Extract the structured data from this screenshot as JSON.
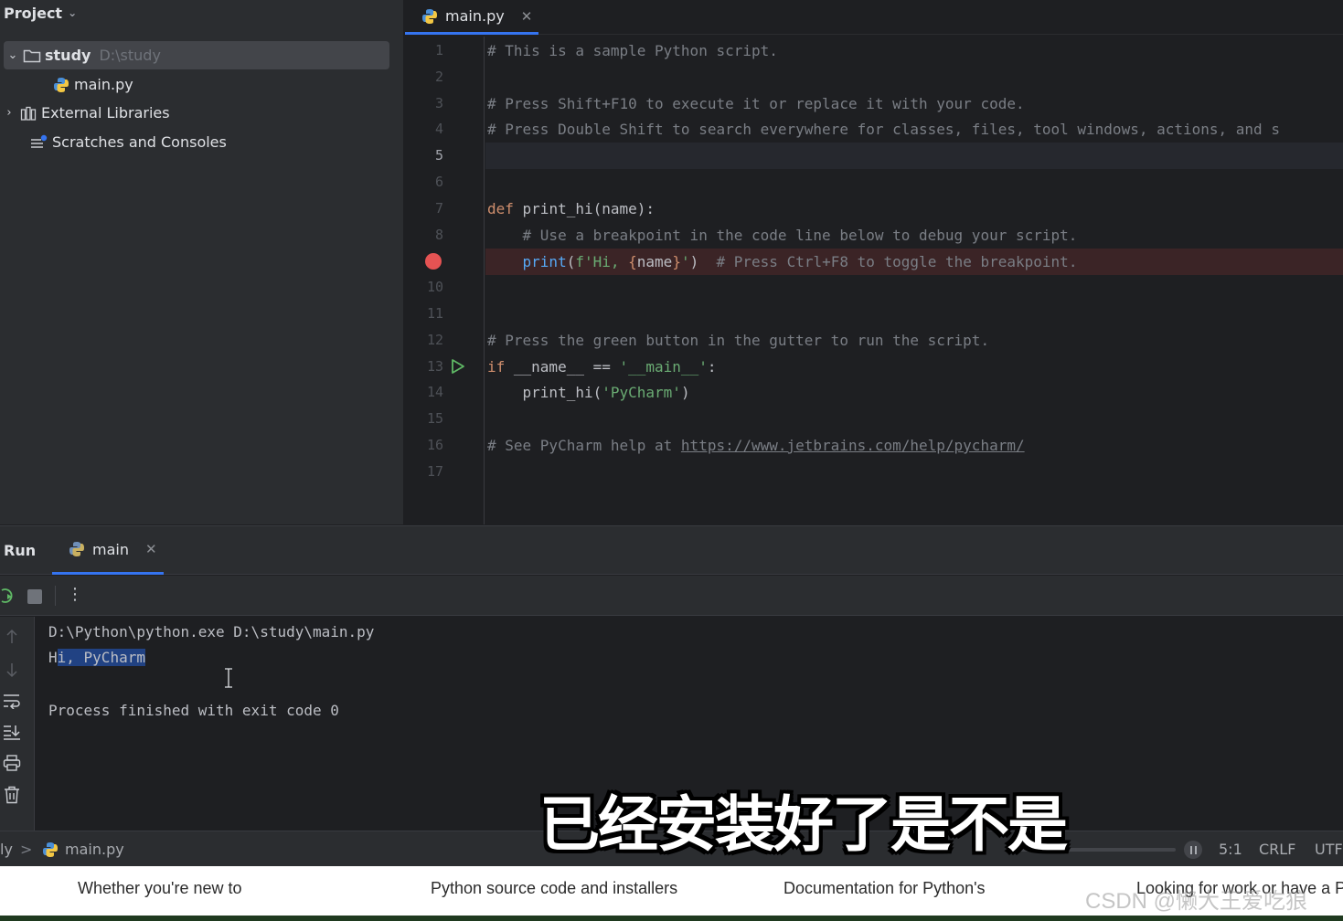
{
  "project": {
    "header": "Project",
    "root_name": "study",
    "root_path": "D:\\study",
    "file": "main.py",
    "external_libraries": "External Libraries",
    "scratches": "Scratches and Consoles"
  },
  "editor": {
    "tab_label": "main.py",
    "line_numbers": [
      "1",
      "2",
      "3",
      "4",
      "5",
      "6",
      "7",
      "8",
      "9",
      "10",
      "11",
      "12",
      "13",
      "14",
      "15",
      "16",
      "17"
    ],
    "current_line": 5,
    "breakpoint_line": 9,
    "run_gutter_line": 13,
    "code": {
      "l1": "# This is a sample Python script.",
      "l3": "# Press Shift+F10 to execute it or replace it with your code.",
      "l4": "# Press Double Shift to search everywhere for classes, files, tool windows, actions, and s",
      "l7_kw": "def",
      "l7_rest": " print_hi(name):",
      "l8": "    # Use a breakpoint in the code line below to debug your script.",
      "l9_indent": "    ",
      "l9_fn": "print",
      "l9_open": "(",
      "l9_str1": "f'Hi, ",
      "l9_brace_open": "{",
      "l9_var": "name",
      "l9_brace_close": "}",
      "l9_str2": "'",
      "l9_close": ")",
      "l9_comment": "  # Press Ctrl+F8 to toggle the breakpoint.",
      "l12": "# Press the green button in the gutter to run the script.",
      "l13_kw": "if",
      "l13_mid": " __name__ == ",
      "l13_str": "'__main__'",
      "l13_end": ":",
      "l14_pre": "    print_hi(",
      "l14_str": "'PyCharm'",
      "l14_end": ")",
      "l16_pre": "# See PyCharm help at ",
      "l16_link": "https://www.jetbrains.com/help/pycharm/"
    }
  },
  "run": {
    "title": "Run",
    "tab_label": "main",
    "console": {
      "command": "D:\\Python\\python.exe D:\\study\\main.py",
      "out_first": "H",
      "out_selected": "i, PyCharm",
      "finished": "Process finished with exit code 0"
    }
  },
  "status": {
    "crumb_prefix": "ly",
    "crumb_sep": ">",
    "crumb_file": "main.py",
    "position": "5:1",
    "line_sep": "CRLF",
    "encoding": "UTF-"
  },
  "subtitle": "已经安装好了是不是",
  "browser": {
    "items": [
      "Whether you're new to",
      "Python source code and installers",
      "Documentation for Python's",
      "Looking for work or have a P"
    ],
    "watermark": "CSDN @懒大王爱吃狼"
  },
  "colors": {
    "accent": "#3574f0",
    "breakpoint": "#e55353",
    "run_green": "#5fb865"
  }
}
